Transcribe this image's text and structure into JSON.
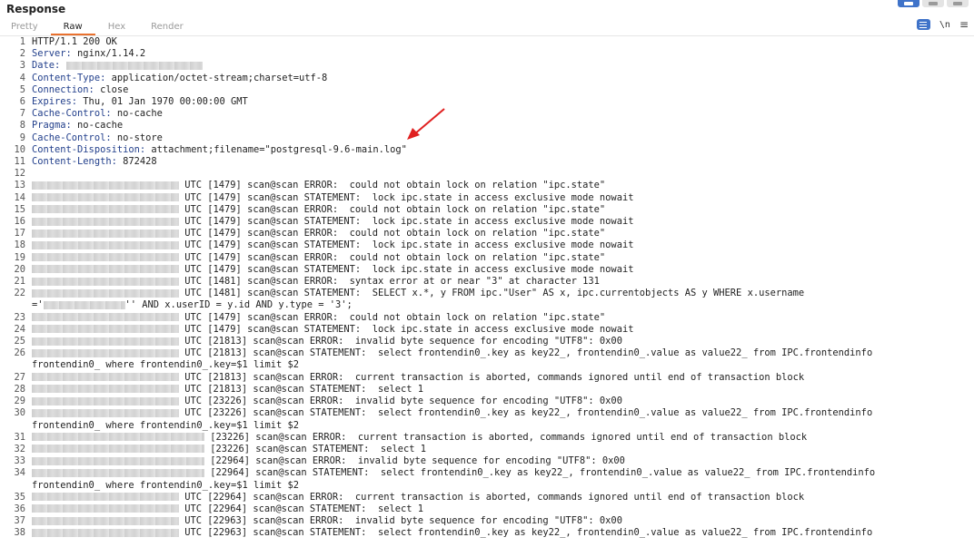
{
  "panel": {
    "title": "Response"
  },
  "tabs": [
    {
      "label": "Pretty"
    },
    {
      "label": "Raw"
    },
    {
      "label": "Hex"
    },
    {
      "label": "Render"
    }
  ],
  "toolbar": {
    "newline_label": "\\n",
    "menu_glyph": "≡"
  },
  "headers": [
    {
      "num": "1",
      "text": "HTTP/1.1 200 OK"
    },
    {
      "num": "2",
      "key": "Server:",
      "value": " nginx/1.14.2"
    },
    {
      "num": "3",
      "key": "Date:",
      "value": " "
    },
    {
      "num": "4",
      "key": "Content-Type:",
      "value": " application/octet-stream;charset=utf-8"
    },
    {
      "num": "5",
      "key": "Connection:",
      "value": " close"
    },
    {
      "num": "6",
      "key": "Expires:",
      "value": " Thu, 01 Jan 1970 00:00:00 GMT"
    },
    {
      "num": "7",
      "key": "Cache-Control:",
      "value": " no-cache"
    },
    {
      "num": "8",
      "key": "Pragma:",
      "value": " no-cache"
    },
    {
      "num": "9",
      "key": "Cache-Control:",
      "value": " no-store"
    },
    {
      "num": "10",
      "key": "Content-Disposition:",
      "value": " attachment;filename=\"postgresql-9.6-main.log\""
    },
    {
      "num": "11",
      "key": "Content-Length:",
      "value": " 872428"
    },
    {
      "num": "12",
      "text": ""
    }
  ],
  "log": [
    {
      "num": "13",
      "text": " UTC [1479] scan@scan ERROR:  could not obtain lock on relation \"ipc.state\""
    },
    {
      "num": "14",
      "text": " UTC [1479] scan@scan STATEMENT:  lock ipc.state in access exclusive mode nowait"
    },
    {
      "num": "15",
      "text": " UTC [1479] scan@scan ERROR:  could not obtain lock on relation \"ipc.state\""
    },
    {
      "num": "16",
      "text": " UTC [1479] scan@scan STATEMENT:  lock ipc.state in access exclusive mode nowait"
    },
    {
      "num": "17",
      "text": " UTC [1479] scan@scan ERROR:  could not obtain lock on relation \"ipc.state\""
    },
    {
      "num": "18",
      "text": " UTC [1479] scan@scan STATEMENT:  lock ipc.state in access exclusive mode nowait"
    },
    {
      "num": "19",
      "text": " UTC [1479] scan@scan ERROR:  could not obtain lock on relation \"ipc.state\""
    },
    {
      "num": "20",
      "text": " UTC [1479] scan@scan STATEMENT:  lock ipc.state in access exclusive mode nowait"
    },
    {
      "num": "21",
      "text": " UTC [1481] scan@scan ERROR:  syntax error at or near \"3\" at character 131"
    },
    {
      "num": "22",
      "text": " UTC [1481] scan@scan STATEMENT:  SELECT x.*, y FROM ipc.\"User\" AS x, ipc.currentobjects AS y WHERE x.username"
    },
    {
      "num": "",
      "text": "'' AND x.userID = y.id AND y.type = '3';",
      "prefix": "='"
    },
    {
      "num": "23",
      "text": " UTC [1479] scan@scan ERROR:  could not obtain lock on relation \"ipc.state\""
    },
    {
      "num": "24",
      "text": " UTC [1479] scan@scan STATEMENT:  lock ipc.state in access exclusive mode nowait"
    },
    {
      "num": "25",
      "text": " UTC [21813] scan@scan ERROR:  invalid byte sequence for encoding \"UTF8\": 0x00"
    },
    {
      "num": "26",
      "text": " UTC [21813] scan@scan STATEMENT:  select frontendin0_.key as key22_, frontendin0_.value as value22_ from IPC.frontendinfo"
    },
    {
      "num": "",
      "text": "frontendin0_ where frontendin0_.key=$1 limit $2",
      "cont": true
    },
    {
      "num": "27",
      "text": " UTC [21813] scan@scan ERROR:  current transaction is aborted, commands ignored until end of transaction block"
    },
    {
      "num": "28",
      "text": " UTC [21813] scan@scan STATEMENT:  select 1"
    },
    {
      "num": "29",
      "text": " UTC [23226] scan@scan ERROR:  invalid byte sequence for encoding \"UTF8\": 0x00"
    },
    {
      "num": "30",
      "text": " UTC [23226] scan@scan STATEMENT:  select frontendin0_.key as key22_, frontendin0_.value as value22_ from IPC.frontendinfo"
    },
    {
      "num": "",
      "text": "frontendin0_ where frontendin0_.key=$1 limit $2",
      "cont": true
    },
    {
      "num": "31",
      "text": " [23226] scan@scan ERROR:  current transaction is aborted, commands ignored until end of transaction block",
      "wide": true
    },
    {
      "num": "32",
      "text": " [23226] scan@scan STATEMENT:  select 1",
      "wide": true
    },
    {
      "num": "33",
      "text": " [22964] scan@scan ERROR:  invalid byte sequence for encoding \"UTF8\": 0x00",
      "wide": true
    },
    {
      "num": "34",
      "text": " [22964] scan@scan STATEMENT:  select frontendin0_.key as key22_, frontendin0_.value as value22_ from IPC.frontendinfo",
      "wide": true
    },
    {
      "num": "",
      "text": "frontendin0_ where frontendin0_.key=$1 limit $2",
      "cont": true
    },
    {
      "num": "35",
      "text": " UTC [22964] scan@scan ERROR:  current transaction is aborted, commands ignored until end of transaction block"
    },
    {
      "num": "36",
      "text": " UTC [22964] scan@scan STATEMENT:  select 1"
    },
    {
      "num": "37",
      "text": " UTC [22963] scan@scan ERROR:  invalid byte sequence for encoding \"UTF8\": 0x00"
    },
    {
      "num": "38",
      "text": " UTC [22963] scan@scan STATEMENT:  select frontendin0_.key as key22_, frontendin0_.value as value22_ from IPC.frontendinfo"
    }
  ],
  "colors": {
    "accent_tab": "#e8712e",
    "header_key": "#23408c",
    "annotation_arrow": "#e02020"
  }
}
